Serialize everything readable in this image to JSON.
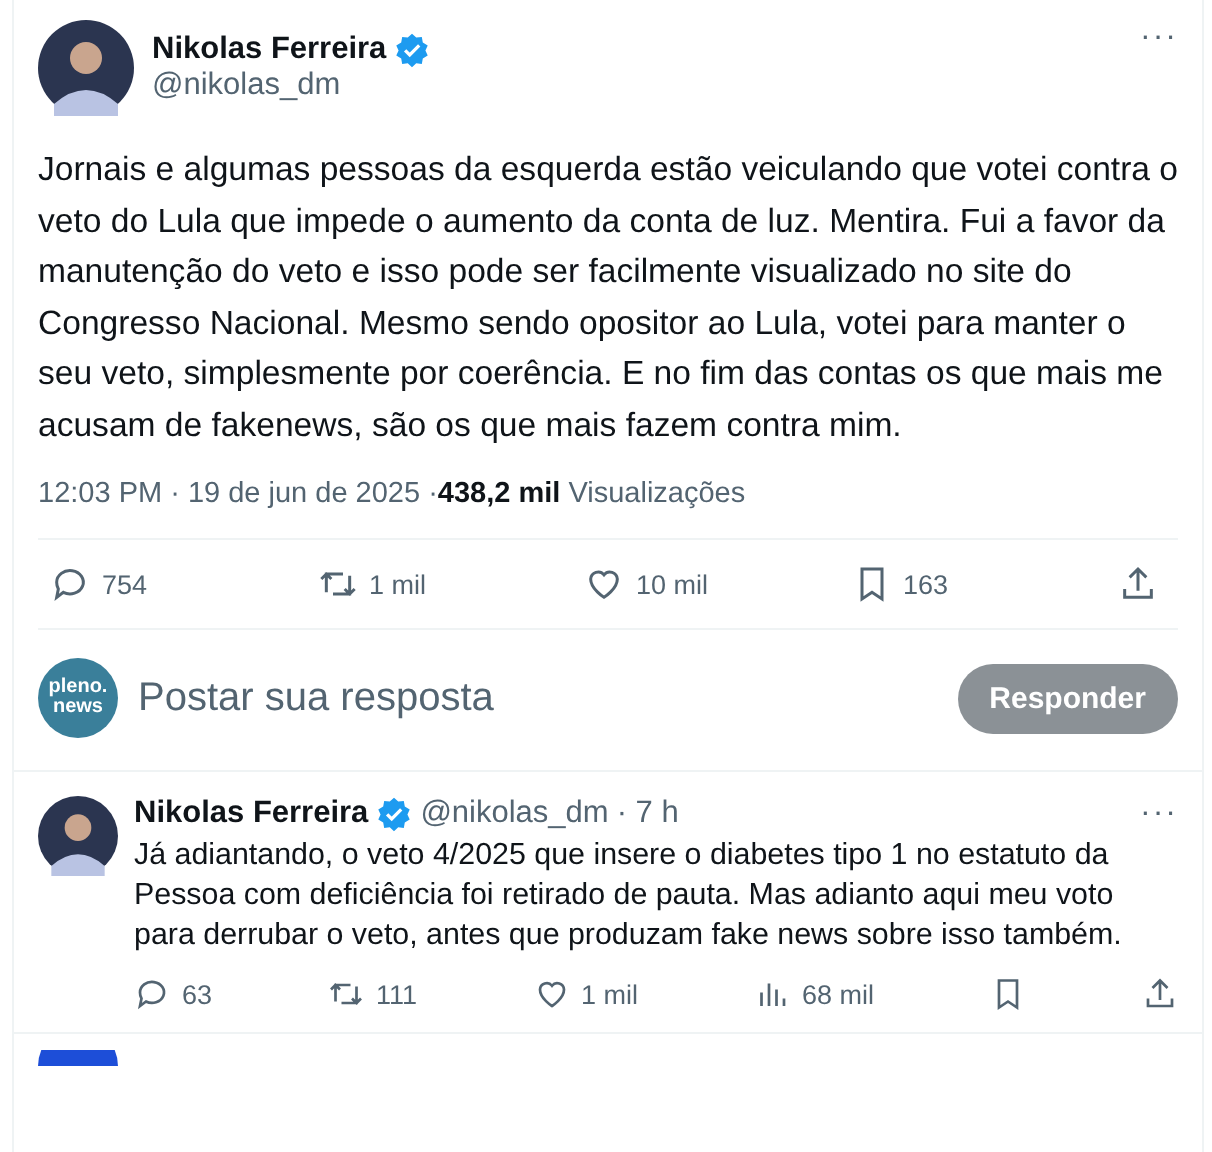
{
  "post": {
    "name": "Nikolas Ferreira",
    "verified": true,
    "handle": "@nikolas_dm",
    "more": "···",
    "text": "Jornais e algumas pessoas da esquerda estão veiculando que votei contra o veto do Lula que impede o aumento da conta de luz. Mentira. Fui a favor da manutenção do veto e isso pode ser facilmente visualizado no site do Congresso Nacional. Mesmo sendo opositor ao Lula, votei para manter o seu veto, simplesmente por coerência. E no fim das contas os que mais me acusam de fakenews, são os que mais fazem contra mim.",
    "time": "12:03 PM · 19 de jun de 2025 · ",
    "views": "438,2 mil",
    "views_label": "Visualizações",
    "actions": [
      {
        "kind": "reply",
        "count": "754"
      },
      {
        "kind": "repost",
        "count": "1 mil"
      },
      {
        "kind": "like",
        "count": "10 mil"
      },
      {
        "kind": "bookmark",
        "count": "163"
      },
      {
        "kind": "share"
      }
    ]
  },
  "composer": {
    "logo": [
      "pleno.",
      "news"
    ],
    "placeholder": "Postar sua resposta",
    "button": "Responder"
  },
  "replies": [
    {
      "name": "Nikolas Ferreira",
      "verified": true,
      "handle": "@nikolas_dm",
      "age": " · 7 h",
      "more": "···",
      "text": "Já adiantando, o veto 4/2025 que insere o diabetes tipo 1 no estatuto da Pessoa com deficiência foi retirado de pauta. Mas adianto aqui meu voto para derrubar o veto, antes que produzam fake news sobre isso também.",
      "actions": [
        {
          "kind": "reply",
          "count": "63"
        },
        {
          "kind": "repost",
          "count": "111"
        },
        {
          "kind": "like",
          "count": "1 mil"
        },
        {
          "kind": "views",
          "count": "68 mil"
        },
        {
          "kind": "bookmark"
        },
        {
          "kind": "share"
        }
      ]
    }
  ]
}
